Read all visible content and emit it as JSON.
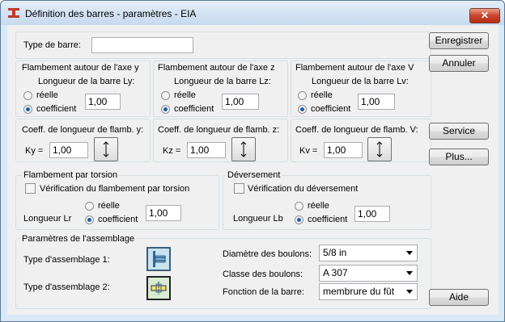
{
  "window": {
    "title": "Définition des barres - paramètres - EIA",
    "close_label": "✕"
  },
  "bar_type": {
    "label": "Type de barre:",
    "value": ""
  },
  "buttons": {
    "save": "Enregistrer",
    "cancel": "Annuler",
    "service": "Service",
    "more": "Plus...",
    "help": "Aide"
  },
  "buckling": [
    {
      "title": "Flambement autour de l'axe y",
      "length_label": "Longueur de la barre Ly:",
      "opt_real": "réelle",
      "opt_coeff": "coefficient",
      "value": "1,00",
      "coeff_title": "Coeff. de longueur de flamb. y:",
      "k_label": "Ky =",
      "k_value": "1,00"
    },
    {
      "title": "Flambement autour de l'axe z",
      "length_label": "Longueur de la barre Lz:",
      "opt_real": "réelle",
      "opt_coeff": "coefficient",
      "value": "1,00",
      "coeff_title": "Coeff. de longueur de flamb. z:",
      "k_label": "Kz =",
      "k_value": "1,00"
    },
    {
      "title": "Flambement autour de l'axe V",
      "length_label": "Longueur de la barre Lv:",
      "opt_real": "réelle",
      "opt_coeff": "coefficient",
      "value": "1,00",
      "coeff_title": "Coeff. de longueur de flamb. V:",
      "k_label": "Kv =",
      "k_value": "1,00"
    }
  ],
  "torsion": {
    "title": "Flambement par torsion",
    "check_label": "Vérification du flambement par torsion",
    "length_label": "Longueur Lr",
    "opt_real": "réelle",
    "opt_coeff": "coefficient",
    "value": "1,00"
  },
  "lateral": {
    "title": "Déversement",
    "check_label": "Vérification du déversement",
    "length_label": "Longueur Lb",
    "opt_real": "réelle",
    "opt_coeff": "coefficient",
    "value": "1,00"
  },
  "assembly": {
    "title": "Paramètres de l'assemblage",
    "type1_label": "Type d'assemblage 1:",
    "type2_label": "Type d'assemblage 2:",
    "bolt_diameter_label": "Diamètre des boulons:",
    "bolt_diameter_value": "5/8 in",
    "bolt_class_label": "Classe des boulons:",
    "bolt_class_value": "A 307",
    "bar_function_label": "Fonction de la barre:",
    "bar_function_value": "membrure du fût"
  }
}
